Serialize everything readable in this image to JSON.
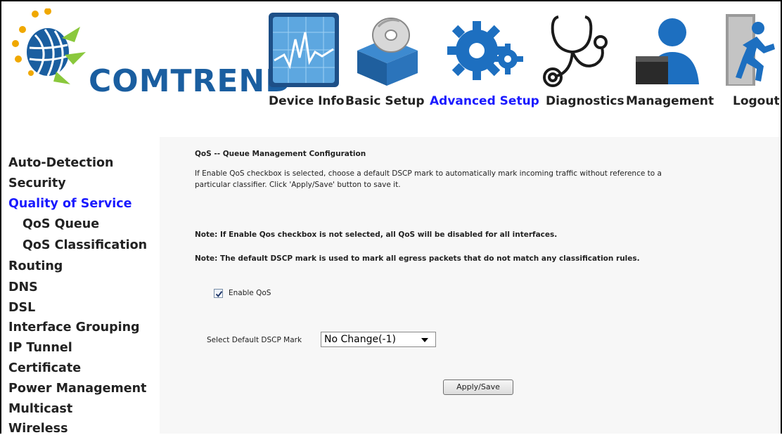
{
  "brand": {
    "name": "COMTREND"
  },
  "nav": {
    "items": [
      {
        "label": "Device Info",
        "icon": "device-info-chart-icon"
      },
      {
        "label": "Basic Setup",
        "icon": "basic-setup-box-disc-icon"
      },
      {
        "label": "Advanced Setup",
        "icon": "advanced-setup-gears-icon",
        "active": true
      },
      {
        "label": "Diagnostics",
        "icon": "diagnostics-stethoscope-icon"
      },
      {
        "label": "Management",
        "icon": "management-person-icon"
      },
      {
        "label": "Logout",
        "icon": "logout-door-runner-icon"
      }
    ]
  },
  "sidebar": {
    "items": [
      {
        "label": "Auto-Detection"
      },
      {
        "label": "Security"
      },
      {
        "label": "Quality of Service",
        "active": true
      },
      {
        "label": "QoS Queue",
        "sub": true
      },
      {
        "label": "QoS Classification",
        "sub": true
      },
      {
        "label": "Routing"
      },
      {
        "label": "DNS"
      },
      {
        "label": "DSL"
      },
      {
        "label": "Interface Grouping"
      },
      {
        "label": "IP Tunnel"
      },
      {
        "label": "Certificate"
      },
      {
        "label": "Power Management"
      },
      {
        "label": "Multicast"
      },
      {
        "label": "Wireless"
      }
    ]
  },
  "main": {
    "title": "QoS -- Queue Management Configuration",
    "desc_line1": "If Enable QoS checkbox is selected, choose a default DSCP mark to automatically mark incoming traffic without reference to a",
    "desc_line2": "particular classifier. Click 'Apply/Save' button to save it.",
    "note1": "Note: If Enable Qos checkbox is not selected, all QoS will be disabled for all interfaces.",
    "note2": "Note: The default DSCP mark is used to mark all egress packets that do not match any classification rules.",
    "enable_qos_label": "Enable QoS",
    "enable_qos_checked": true,
    "dscp_label": "Select Default DSCP Mark",
    "dscp_value": "No Change(-1)",
    "apply_label": "Apply/Save"
  },
  "colors": {
    "accent": "#1a1aff",
    "brand": "#1a5ea0",
    "content_bg": "#f7f7f7"
  }
}
